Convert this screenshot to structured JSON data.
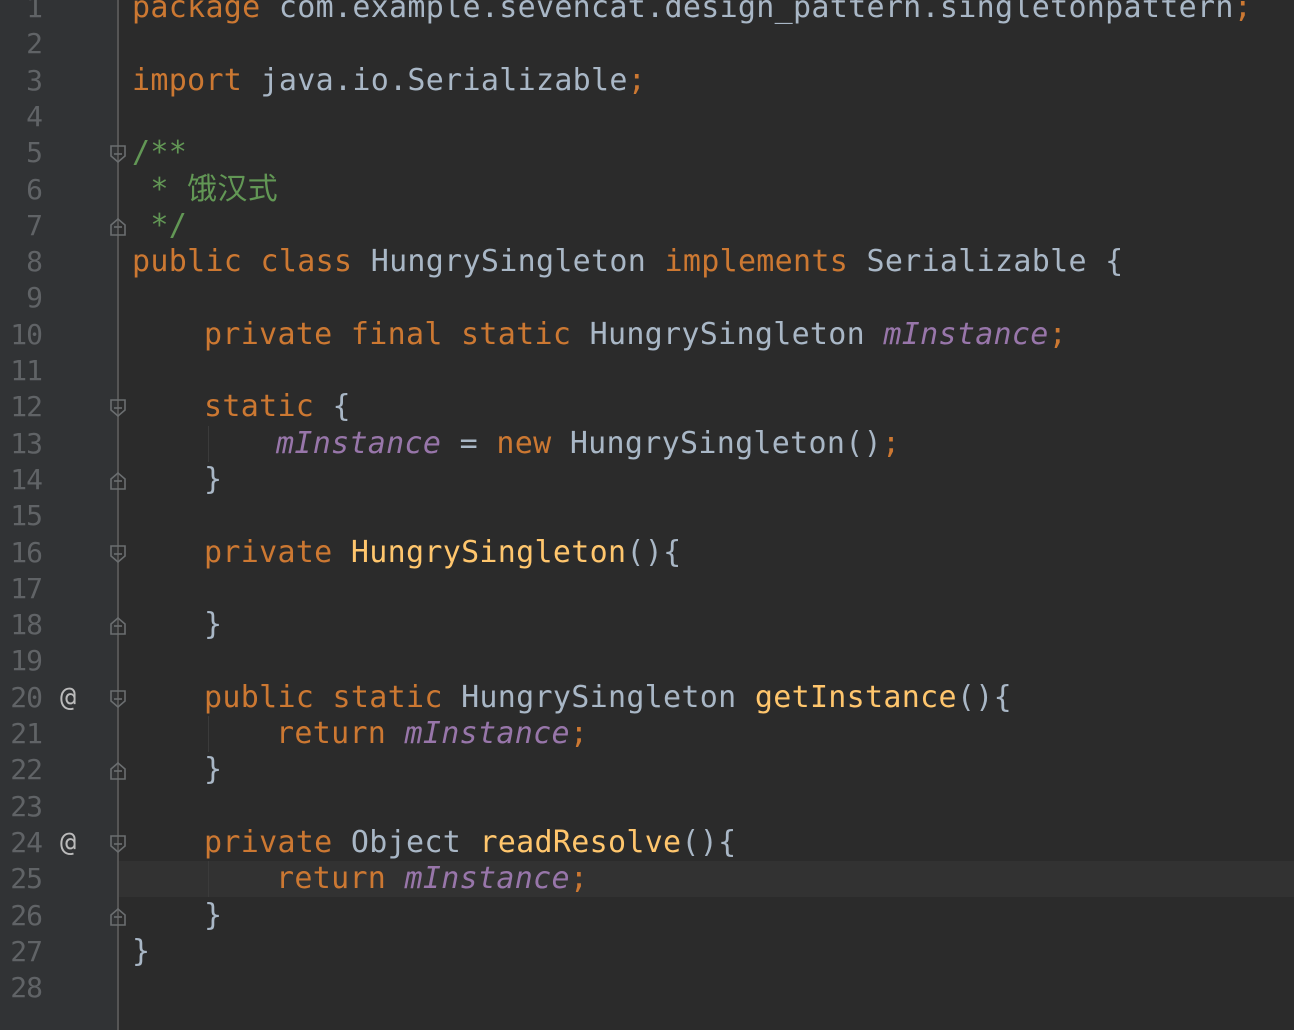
{
  "editor": {
    "language": "java",
    "current_line": 25,
    "colors": {
      "background": "#2b2b2b",
      "gutter": "#313335",
      "keyword": "#cc7832",
      "identifier": "#a9b7c6",
      "doc_comment": "#629755",
      "field": "#9876aa",
      "method": "#ffc66d",
      "line_number": "#606366"
    },
    "lines": [
      {
        "num": "1",
        "marker": "",
        "fold": "",
        "indent": 0,
        "tokens": [
          {
            "t": "package",
            "c": "kw"
          },
          {
            "t": " com.example.sevencat.design_pattern.singletonpattern",
            "c": "id"
          },
          {
            "t": ";",
            "c": "kw"
          }
        ]
      },
      {
        "num": "2",
        "marker": "",
        "fold": "",
        "indent": 0,
        "tokens": []
      },
      {
        "num": "3",
        "marker": "",
        "fold": "",
        "indent": 0,
        "tokens": [
          {
            "t": "import",
            "c": "kw"
          },
          {
            "t": " java.io.Serializable",
            "c": "id"
          },
          {
            "t": ";",
            "c": "kw"
          }
        ]
      },
      {
        "num": "4",
        "marker": "",
        "fold": "",
        "indent": 0,
        "tokens": []
      },
      {
        "num": "5",
        "marker": "",
        "fold": "open",
        "indent": 0,
        "tokens": [
          {
            "t": "/**",
            "c": "doc"
          }
        ]
      },
      {
        "num": "6",
        "marker": "",
        "fold": "",
        "indent": 0,
        "tokens": [
          {
            "t": " * 饿汉式",
            "c": "doc"
          }
        ]
      },
      {
        "num": "7",
        "marker": "",
        "fold": "close",
        "indent": 0,
        "tokens": [
          {
            "t": " */",
            "c": "doc"
          }
        ]
      },
      {
        "num": "8",
        "marker": "",
        "fold": "",
        "indent": 0,
        "tokens": [
          {
            "t": "public class",
            "c": "kw"
          },
          {
            "t": " HungrySingleton ",
            "c": "id"
          },
          {
            "t": "implements",
            "c": "kw"
          },
          {
            "t": " Serializable {",
            "c": "id"
          }
        ]
      },
      {
        "num": "9",
        "marker": "",
        "fold": "",
        "indent": 0,
        "tokens": []
      },
      {
        "num": "10",
        "marker": "",
        "fold": "",
        "indent": 1,
        "tokens": [
          {
            "t": "private final static",
            "c": "kw"
          },
          {
            "t": " HungrySingleton ",
            "c": "id"
          },
          {
            "t": "mInstance",
            "c": "field"
          },
          {
            "t": ";",
            "c": "kw"
          }
        ]
      },
      {
        "num": "11",
        "marker": "",
        "fold": "",
        "indent": 0,
        "tokens": []
      },
      {
        "num": "12",
        "marker": "",
        "fold": "open",
        "indent": 1,
        "tokens": [
          {
            "t": "static",
            "c": "kw"
          },
          {
            "t": " {",
            "c": "id"
          }
        ]
      },
      {
        "num": "13",
        "marker": "",
        "fold": "",
        "indent": 2,
        "tokens": [
          {
            "t": "mInstance",
            "c": "field"
          },
          {
            "t": " = ",
            "c": "id"
          },
          {
            "t": "new",
            "c": "kw"
          },
          {
            "t": " HungrySingleton()",
            "c": "id"
          },
          {
            "t": ";",
            "c": "kw"
          }
        ]
      },
      {
        "num": "14",
        "marker": "",
        "fold": "close",
        "indent": 1,
        "tokens": [
          {
            "t": "}",
            "c": "id"
          }
        ]
      },
      {
        "num": "15",
        "marker": "",
        "fold": "",
        "indent": 0,
        "tokens": []
      },
      {
        "num": "16",
        "marker": "",
        "fold": "open",
        "indent": 1,
        "tokens": [
          {
            "t": "private",
            "c": "kw"
          },
          {
            "t": " ",
            "c": "id"
          },
          {
            "t": "HungrySingleton",
            "c": "fn"
          },
          {
            "t": "(){",
            "c": "id"
          }
        ]
      },
      {
        "num": "17",
        "marker": "",
        "fold": "",
        "indent": 0,
        "tokens": []
      },
      {
        "num": "18",
        "marker": "",
        "fold": "close",
        "indent": 1,
        "tokens": [
          {
            "t": "}",
            "c": "id"
          }
        ]
      },
      {
        "num": "19",
        "marker": "",
        "fold": "",
        "indent": 0,
        "tokens": []
      },
      {
        "num": "20",
        "marker": "@",
        "fold": "open",
        "indent": 1,
        "tokens": [
          {
            "t": "public static",
            "c": "kw"
          },
          {
            "t": " HungrySingleton ",
            "c": "id"
          },
          {
            "t": "getInstance",
            "c": "fn"
          },
          {
            "t": "(){",
            "c": "id"
          }
        ]
      },
      {
        "num": "21",
        "marker": "",
        "fold": "",
        "indent": 2,
        "tokens": [
          {
            "t": "return",
            "c": "kw"
          },
          {
            "t": " ",
            "c": "id"
          },
          {
            "t": "mInstance",
            "c": "field"
          },
          {
            "t": ";",
            "c": "kw"
          }
        ]
      },
      {
        "num": "22",
        "marker": "",
        "fold": "close",
        "indent": 1,
        "tokens": [
          {
            "t": "}",
            "c": "id"
          }
        ]
      },
      {
        "num": "23",
        "marker": "",
        "fold": "",
        "indent": 0,
        "tokens": []
      },
      {
        "num": "24",
        "marker": "@",
        "fold": "open",
        "indent": 1,
        "tokens": [
          {
            "t": "private",
            "c": "kw"
          },
          {
            "t": " Object ",
            "c": "id"
          },
          {
            "t": "readResolve",
            "c": "fn"
          },
          {
            "t": "(){",
            "c": "id"
          }
        ]
      },
      {
        "num": "25",
        "marker": "",
        "fold": "",
        "indent": 2,
        "tokens": [
          {
            "t": "return",
            "c": "kw"
          },
          {
            "t": " ",
            "c": "id"
          },
          {
            "t": "mInstance",
            "c": "field"
          },
          {
            "t": ";",
            "c": "kw"
          }
        ]
      },
      {
        "num": "26",
        "marker": "",
        "fold": "close",
        "indent": 1,
        "tokens": [
          {
            "t": "}",
            "c": "id"
          }
        ]
      },
      {
        "num": "27",
        "marker": "",
        "fold": "",
        "indent": 0,
        "tokens": [
          {
            "t": "}",
            "c": "id"
          }
        ]
      },
      {
        "num": "28",
        "marker": "",
        "fold": "",
        "indent": 0,
        "tokens": []
      }
    ]
  }
}
